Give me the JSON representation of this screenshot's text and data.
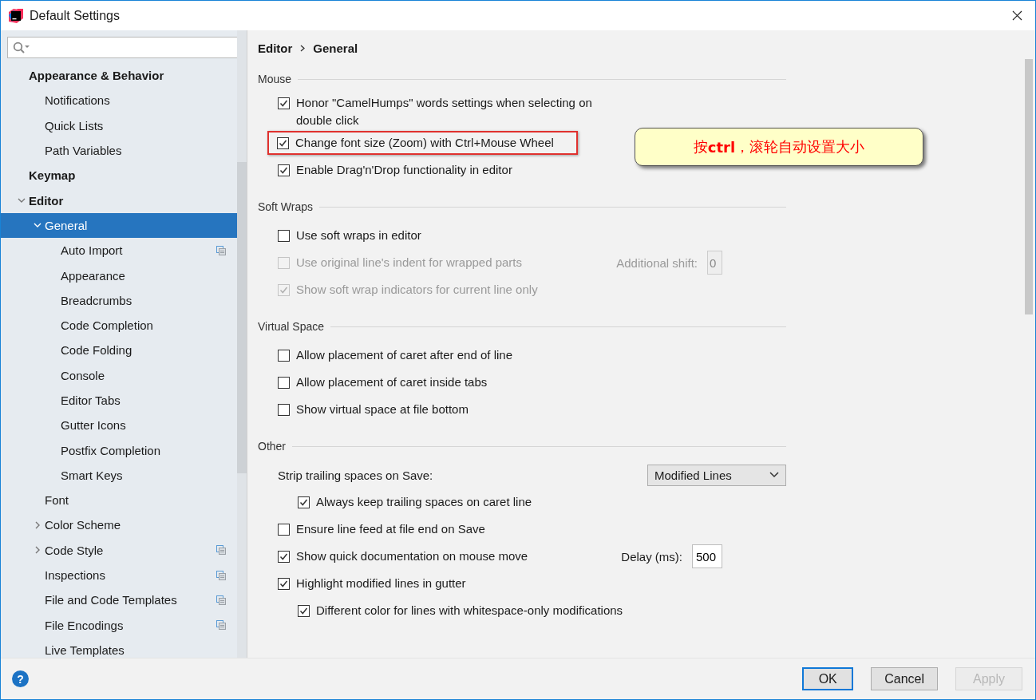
{
  "window": {
    "title": "Default Settings"
  },
  "sidebar": {
    "items": [
      {
        "label": "Appearance & Behavior",
        "selected": false,
        "project_level": false,
        "children": [
          {
            "label": "Notifications",
            "selected": false,
            "project_level": false
          },
          {
            "label": "Quick Lists",
            "selected": false,
            "project_level": false
          },
          {
            "label": "Path Variables",
            "selected": false,
            "project_level": false
          }
        ]
      },
      {
        "label": "Keymap",
        "selected": false,
        "project_level": false
      },
      {
        "label": "Editor",
        "selected": false,
        "project_level": false,
        "expanded": true,
        "children": [
          {
            "label": "General",
            "selected": true,
            "project_level": false,
            "expanded": true,
            "children": [
              {
                "label": "Auto Import",
                "selected": false,
                "project_level": true
              },
              {
                "label": "Appearance",
                "selected": false,
                "project_level": false
              },
              {
                "label": "Breadcrumbs",
                "selected": false,
                "project_level": false
              },
              {
                "label": "Code Completion",
                "selected": false,
                "project_level": false
              },
              {
                "label": "Code Folding",
                "selected": false,
                "project_level": false
              },
              {
                "label": "Console",
                "selected": false,
                "project_level": false
              },
              {
                "label": "Editor Tabs",
                "selected": false,
                "project_level": false
              },
              {
                "label": "Gutter Icons",
                "selected": false,
                "project_level": false
              },
              {
                "label": "Postfix Completion",
                "selected": false,
                "project_level": false
              },
              {
                "label": "Smart Keys",
                "selected": false,
                "project_level": false
              }
            ]
          },
          {
            "label": "Font",
            "selected": false,
            "project_level": false
          },
          {
            "label": "Color Scheme",
            "selected": false,
            "project_level": false,
            "expanded": false
          },
          {
            "label": "Code Style",
            "selected": false,
            "project_level": true,
            "expanded": false
          },
          {
            "label": "Inspections",
            "selected": false,
            "project_level": true
          },
          {
            "label": "File and Code Templates",
            "selected": false,
            "project_level": true
          },
          {
            "label": "File Encodings",
            "selected": false,
            "project_level": true
          },
          {
            "label": "Live Templates",
            "selected": false,
            "project_level": false
          }
        ]
      }
    ]
  },
  "breadcrumb": [
    "Editor",
    "General"
  ],
  "sections": [
    {
      "title": "Mouse",
      "rows": [
        {
          "kind": "checkbox",
          "label": "Honor \"CamelHumps\" words settings when selecting on double click",
          "checked": true,
          "disabled": false,
          "highlighted": false
        },
        {
          "kind": "checkbox",
          "label": "Change font size (Zoom) with Ctrl+Mouse Wheel",
          "checked": true,
          "disabled": false,
          "highlighted": true
        },
        {
          "kind": "checkbox",
          "label": "Enable Drag'n'Drop functionality in editor",
          "checked": true,
          "disabled": false,
          "highlighted": false
        }
      ]
    },
    {
      "title": "Soft Wraps",
      "rows": [
        {
          "kind": "checkbox",
          "label": "Use soft wraps in editor",
          "checked": false,
          "disabled": false,
          "highlighted": false
        },
        {
          "kind": "checkbox",
          "label": "Use original line's indent for wrapped parts",
          "checked": false,
          "disabled": true,
          "highlighted": false,
          "field": {
            "label": "Additional shift:",
            "value": "0"
          }
        },
        {
          "kind": "checkbox",
          "label": "Show soft wrap indicators for current line only",
          "checked": true,
          "disabled": true,
          "highlighted": false
        }
      ]
    },
    {
      "title": "Virtual Space",
      "rows": [
        {
          "kind": "checkbox",
          "label": "Allow placement of caret after end of line",
          "checked": false,
          "disabled": false,
          "highlighted": false
        },
        {
          "kind": "checkbox",
          "label": "Allow placement of caret inside tabs",
          "checked": false,
          "disabled": false,
          "highlighted": false
        },
        {
          "kind": "checkbox",
          "label": "Show virtual space at file bottom",
          "checked": false,
          "disabled": false,
          "highlighted": false
        }
      ]
    },
    {
      "title": "Other",
      "rows": [
        {
          "kind": "select",
          "label": "Strip trailing spaces on Save:",
          "value": "Modified Lines",
          "children": [
            {
              "kind": "checkbox",
              "label": "Always keep trailing spaces on caret line",
              "checked": true,
              "disabled": false,
              "highlighted": false
            }
          ]
        },
        {
          "kind": "checkbox",
          "label": "Ensure line feed at file end on Save",
          "checked": false,
          "disabled": false,
          "highlighted": false
        },
        {
          "kind": "checkbox",
          "label": "Show quick documentation on mouse move",
          "checked": true,
          "disabled": false,
          "highlighted": false,
          "field": {
            "label": "Delay (ms):",
            "value": "500"
          }
        },
        {
          "kind": "checkbox",
          "label": "Highlight modified lines in gutter",
          "checked": true,
          "disabled": false,
          "highlighted": false,
          "children": [
            {
              "kind": "checkbox",
              "label": "Different color for lines with whitespace-only modifications",
              "checked": true,
              "disabled": false,
              "highlighted": false
            }
          ]
        }
      ]
    }
  ],
  "callout": {
    "text": "按**ctrl**，滚轮自动设置大小"
  },
  "footer": {
    "help": "?",
    "buttons": [
      {
        "label": "OK",
        "kind": "default",
        "disabled": false
      },
      {
        "label": "Cancel",
        "kind": "normal",
        "disabled": false
      },
      {
        "label": "Apply",
        "kind": "normal",
        "disabled": true
      }
    ]
  }
}
